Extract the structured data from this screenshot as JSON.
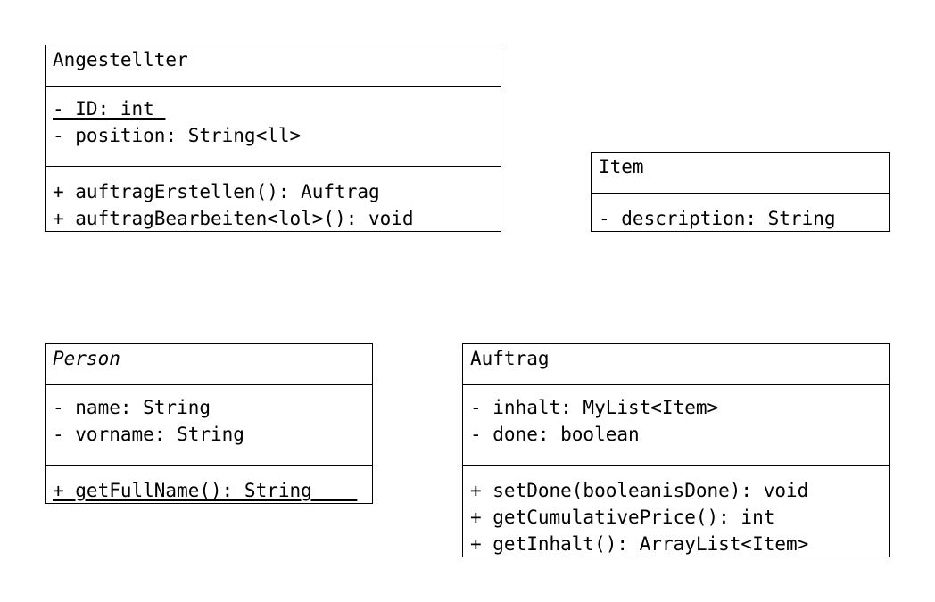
{
  "classes": {
    "angestellter": {
      "name": "Angestellter",
      "attributes": [
        "- ID: int ",
        "- position: String<ll>"
      ],
      "operations": [
        "+ auftragErstellen(): Auftrag",
        "+ auftragBearbeiten<lol>(): void"
      ]
    },
    "item": {
      "name": "Item",
      "attributes": [
        "- description: String"
      ]
    },
    "person": {
      "name": "Person",
      "attributes": [
        "- name: String",
        "- vorname: String"
      ],
      "operations": [
        "+ getFullName(): String    "
      ]
    },
    "auftrag": {
      "name": "Auftrag",
      "attributes": [
        "- inhalt: MyList<Item>",
        "- done: boolean"
      ],
      "operations": [
        "+ setDone(booleanisDone): void",
        "+ getCumulativePrice(): int",
        "+ getInhalt(): ArrayList<Item>"
      ]
    }
  }
}
